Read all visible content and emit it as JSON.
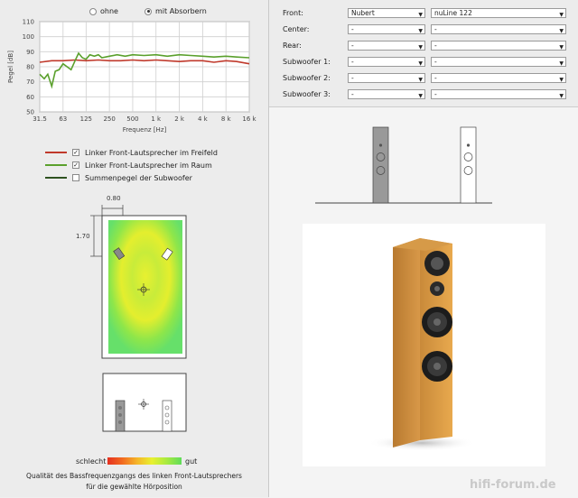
{
  "mode": {
    "options": [
      {
        "label": "ohne",
        "selected": false
      },
      {
        "label": "mit Absorbern",
        "selected": true
      }
    ]
  },
  "chart_data": {
    "type": "line",
    "xlabel": "Frequenz [Hz]",
    "ylabel": "Pegel [dB]",
    "x_ticks": [
      "31.5",
      "63",
      "125",
      "250",
      "500",
      "1 k",
      "2 k",
      "4 k",
      "8 k",
      "16 k"
    ],
    "y_ticks": [
      "110",
      "100",
      "90",
      "80",
      "70",
      "60",
      "50"
    ],
    "ylim": [
      50,
      110
    ],
    "grid": true,
    "series": [
      {
        "name": "Linker Front-Lautsprecher im Freifeld",
        "color": "#c0392b",
        "x": [
          31.5,
          45,
          63,
          90,
          125,
          180,
          250,
          350,
          500,
          700,
          1000,
          1400,
          2000,
          2800,
          4000,
          5600,
          8000,
          11000,
          16000
        ],
        "y": [
          83,
          84,
          84,
          84.5,
          84,
          84.5,
          84,
          84,
          84.5,
          84,
          84.5,
          84,
          83.5,
          84,
          84,
          83,
          84,
          83.5,
          82
        ]
      },
      {
        "name": "Linker Front-Lautsprecher im Raum",
        "color": "#5aa02c",
        "x": [
          31.5,
          36,
          40,
          45,
          50,
          56,
          63,
          71,
          80,
          90,
          100,
          112,
          125,
          140,
          160,
          180,
          200,
          250,
          315,
          400,
          500,
          700,
          1000,
          1400,
          2000,
          2800,
          4000,
          5600,
          8000,
          11000,
          16000
        ],
        "y": [
          75,
          72,
          75,
          67,
          77,
          78,
          82,
          80,
          78,
          84,
          89,
          86,
          85,
          88,
          87,
          88,
          86,
          87,
          88,
          87,
          88,
          87.5,
          88,
          87,
          88,
          87.5,
          87,
          86.5,
          87,
          86.5,
          86
        ]
      },
      {
        "name": "Summenpegel der Subwoofer",
        "color": "#2e5220",
        "x": [],
        "y": []
      }
    ]
  },
  "legend": [
    {
      "label": "Linker Front-Lautsprecher im Freifeld",
      "checked": true,
      "color": "#c0392b"
    },
    {
      "label": "Linker Front-Lautsprecher im Raum",
      "checked": true,
      "color": "#5aa02c"
    },
    {
      "label": "Summenpegel der Subwoofer",
      "checked": false,
      "color": "#2e5220"
    }
  ],
  "room": {
    "dim_width": "0.80",
    "dim_depth": "1.70"
  },
  "quality": {
    "bad_label": "schlecht",
    "good_label": "gut",
    "caption_line1": "Qualität des Bassfrequenzgangs des linken Front-Lautsprechers",
    "caption_line2": "für die gewählte Hörposition"
  },
  "speakers": [
    {
      "label": "Front:",
      "brand": "Nubert",
      "model": "nuLine 122"
    },
    {
      "label": "Center:",
      "brand": "-",
      "model": "-"
    },
    {
      "label": "Rear:",
      "brand": "-",
      "model": "-"
    },
    {
      "label": "Subwoofer 1:",
      "brand": "-",
      "model": "-"
    },
    {
      "label": "Subwoofer 2:",
      "brand": "-",
      "model": "-"
    },
    {
      "label": "Subwoofer 3:",
      "brand": "-",
      "model": "-"
    }
  ],
  "watermark": "hifi-forum.de"
}
